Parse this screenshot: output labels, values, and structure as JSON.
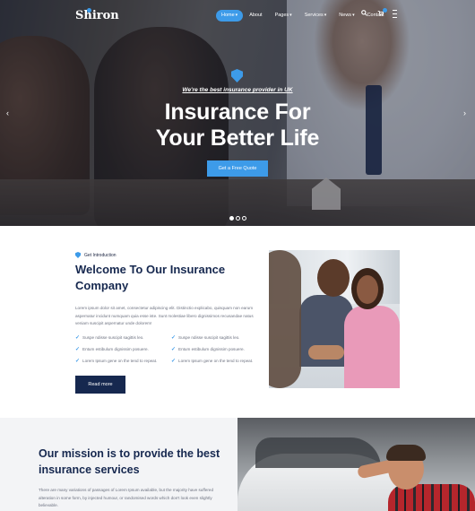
{
  "brand": {
    "name": "Shiron",
    "accent": "#3d9be9",
    "navy": "#16284f"
  },
  "nav": {
    "items": [
      {
        "label": "Home",
        "caret": "▾",
        "active": true
      },
      {
        "label": "About",
        "caret": "",
        "active": false
      },
      {
        "label": "Pages",
        "caret": "▾",
        "active": false
      },
      {
        "label": "Services",
        "caret": "▾",
        "active": false
      },
      {
        "label": "News",
        "caret": "▾",
        "active": false
      },
      {
        "label": "Contact",
        "caret": "",
        "active": false
      }
    ],
    "icons": [
      "search-icon",
      "cart-icon",
      "menu-icon"
    ]
  },
  "hero": {
    "tagline": "We're the best insurance provider in UK",
    "title_line1": "Insurance For",
    "title_line2": "Your Better Life",
    "cta": "Get a Free Quote",
    "prev_icon": "‹",
    "next_icon": "›",
    "slide_count": 3,
    "active_slide": 1
  },
  "welcome": {
    "label": "Get Introduction",
    "title": "Welcome To Our Insurance Company",
    "text": "Lorem ipsum dolor sit amet, consectetur adipiscing elit. Distinctio explicabo, quisquam non earum aspernatur incidunt numquam quia esse iste. Sunt molestiae libero dignissimos recusandae natus veniam suscipit aspernatur unde dolorem!",
    "checklist": [
      "Suspe ndisse suscipit sagittis leo.",
      "Suspe ndisse suscipit sagittis leo.",
      "Entum estibulum dignissim posuere.",
      "Entum estibulum dignissim posuere.",
      "Lorem Ipsum gene on the tend to repeat.",
      "Lorem Ipsum gene on the tend to repeat."
    ],
    "button": "Read more"
  },
  "mission": {
    "title": "Our mission is to provide the best insurance services",
    "text": "There are many variations of passages of Lorem Ipsum available, but the majority have suffered alteration in some form, by injected humour, or randomised words which don't look even slightly believable."
  }
}
